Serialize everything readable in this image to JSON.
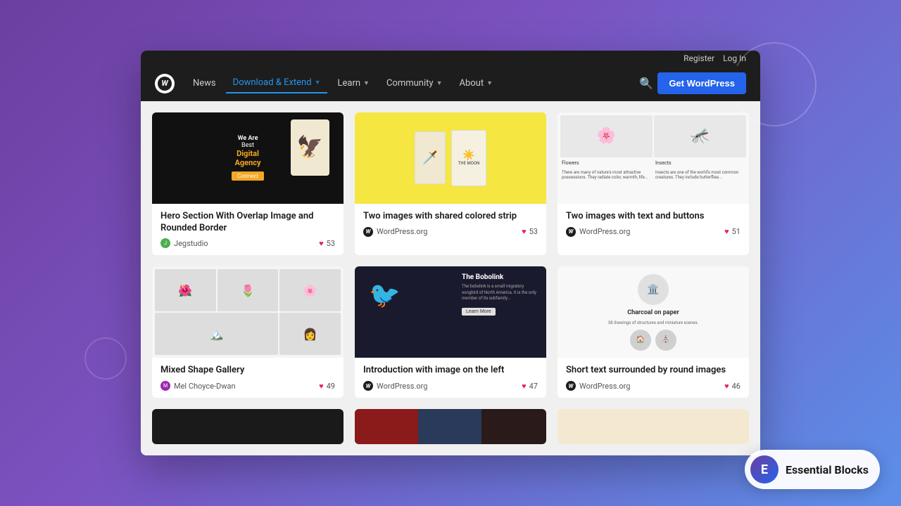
{
  "background": {
    "gradient": "linear-gradient(135deg, #6b3fa0 0%, #7b52c0 40%, #5b8fe8 100%)"
  },
  "nav": {
    "top_bar": {
      "register_label": "Register",
      "login_label": "Log In"
    },
    "links": [
      {
        "label": "News",
        "active": false
      },
      {
        "label": "Download & Extend",
        "active": true,
        "has_chevron": true
      },
      {
        "label": "Learn",
        "active": false,
        "has_chevron": true
      },
      {
        "label": "Community",
        "active": false,
        "has_chevron": true
      },
      {
        "label": "About",
        "active": false,
        "has_chevron": true
      }
    ],
    "get_wp_label": "Get WordPress"
  },
  "cards": [
    {
      "id": "card-1",
      "title": "Hero Section With Overlap Image and Rounded Border",
      "author": "Jegstudio",
      "author_type": "jegstudio",
      "likes": 53,
      "thumb_type": "digital-agency"
    },
    {
      "id": "card-2",
      "title": "Two images with shared colored strip",
      "author": "WordPress.org",
      "author_type": "wordpress",
      "likes": 53,
      "thumb_type": "yellow-strip"
    },
    {
      "id": "card-3",
      "title": "Two images with text and buttons",
      "author": "WordPress.org",
      "author_type": "wordpress",
      "likes": 51,
      "thumb_type": "flowers"
    },
    {
      "id": "card-4",
      "title": "Mixed Shape Gallery",
      "author": "Mel Choyce-Dwan",
      "author_type": "mel",
      "likes": 49,
      "thumb_type": "gallery"
    },
    {
      "id": "card-5",
      "title": "Introduction with image on the left",
      "author": "WordPress.org",
      "author_type": "wordpress",
      "likes": 47,
      "thumb_type": "bobolink"
    },
    {
      "id": "card-6",
      "title": "Short text surrounded by round images",
      "author": "WordPress.org",
      "author_type": "wordpress",
      "likes": 46,
      "thumb_type": "charcoal"
    }
  ],
  "essential_blocks": {
    "label": "Essential Blocks"
  }
}
